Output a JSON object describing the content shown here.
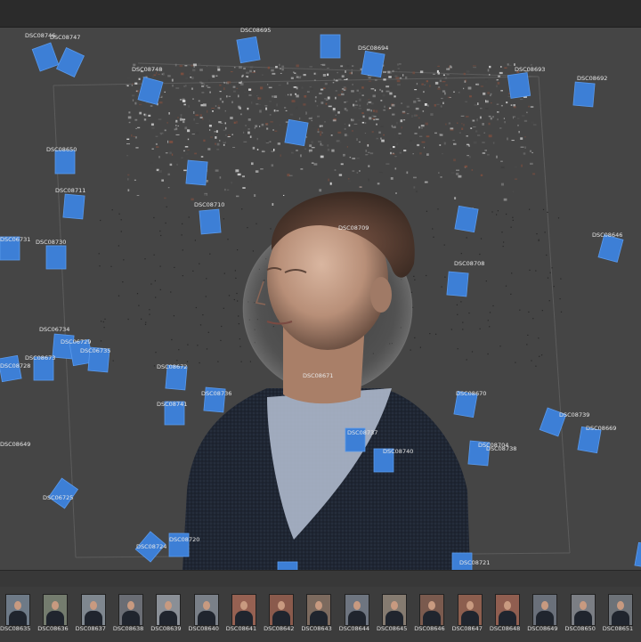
{
  "colors": {
    "camera_fill": "#3d7fd6",
    "camera_stroke": "#5a9aec",
    "background": "#454545",
    "label": "#e8e8e8"
  },
  "cameras": [
    {
      "label": "DSC08746"
    },
    {
      "label": "DSC08747"
    },
    {
      "label": "DSC08695"
    },
    {
      "label": "DSC08694"
    },
    {
      "label": "DSC08748"
    },
    {
      "label": "DSC08693"
    },
    {
      "label": "DSC08692"
    },
    {
      "label": "DSC08650"
    },
    {
      "label": "DSC08711"
    },
    {
      "label": "DSC08710"
    },
    {
      "label": "DSC08709"
    },
    {
      "label": "DSC08646"
    },
    {
      "label": "DSC06731"
    },
    {
      "label": "DSC08730"
    },
    {
      "label": "DSC08708"
    },
    {
      "label": "DSC06734"
    },
    {
      "label": "DSC06729"
    },
    {
      "label": "DSC06735"
    },
    {
      "label": "DSC08673"
    },
    {
      "label": "DSC08728"
    },
    {
      "label": "DSC08672"
    },
    {
      "label": "DSC08671"
    },
    {
      "label": "DSC08736"
    },
    {
      "label": "DSC08670"
    },
    {
      "label": "DSC08741"
    },
    {
      "label": "DSC08739"
    },
    {
      "label": "DSC08669"
    },
    {
      "label": "DSC08737"
    },
    {
      "label": "DSC08704"
    },
    {
      "label": "DSC08738"
    },
    {
      "label": "DSC08740"
    },
    {
      "label": "DSC06725"
    },
    {
      "label": "DSC08720"
    },
    {
      "label": "DSC08724"
    },
    {
      "label": "DSC08721"
    },
    {
      "label": "DSC08649"
    }
  ],
  "filmstrip": [
    {
      "label": "DSC08635"
    },
    {
      "label": "DSC08636"
    },
    {
      "label": "DSC08637"
    },
    {
      "label": "DSC08638"
    },
    {
      "label": "DSC08639"
    },
    {
      "label": "DSC08640"
    },
    {
      "label": "DSC08641"
    },
    {
      "label": "DSC08642"
    },
    {
      "label": "DSC08643"
    },
    {
      "label": "DSC08644"
    },
    {
      "label": "DSC08645"
    },
    {
      "label": "DSC08646"
    },
    {
      "label": "DSC08647"
    },
    {
      "label": "DSC08648"
    },
    {
      "label": "DSC08649"
    },
    {
      "label": "DSC08650"
    },
    {
      "label": "DSC08651"
    }
  ]
}
